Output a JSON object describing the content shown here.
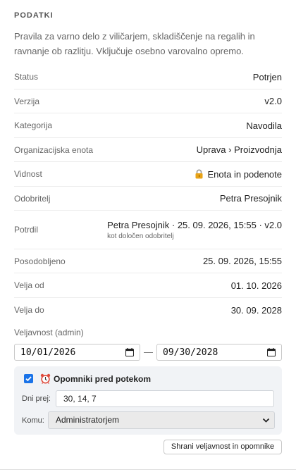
{
  "section": {
    "title": "PODATKI",
    "description": "Pravila za varno delo z viličarjem, skladiščenje na regalih in ravnanje ob razlitju. Vključuje osebno varovalno opremo."
  },
  "fields": [
    {
      "key": "Status",
      "value": "Potrjen"
    },
    {
      "key": "Verzija",
      "value": "v2.0"
    },
    {
      "key": "Kategorija",
      "value": "Navodila"
    },
    {
      "key": "Organizacijska enota",
      "value": "Uprava › Proizvodnja"
    },
    {
      "key": "Vidnost",
      "value": "Enota in podenote",
      "icon": "lock-icon"
    },
    {
      "key": "Odobritelj",
      "value": "Petra Presojnik"
    },
    {
      "key": "Potrdil",
      "value": "Petra Presojnik · 25. 09. 2026, 15:55 · v2.0",
      "sub": "kot določen odobritelj"
    },
    {
      "key": "Posodobljeno",
      "value": "25. 09. 2026, 15:55"
    },
    {
      "key": "Velja od",
      "value": "01. 10. 2026"
    },
    {
      "key": "Velja do",
      "value": "30. 09. 2028"
    }
  ],
  "validity_admin": {
    "label": "Veljavnost (admin)",
    "from": "10/01/2026",
    "to": "09/30/2028",
    "separator": "—"
  },
  "reminders": {
    "checked": true,
    "icon": "alarm-clock-icon",
    "title": "Opomniki pred potekom",
    "days_label": "Dni prej:",
    "days_value": "30, 14, 7",
    "to_label": "Komu:",
    "to_value": "Administratorjem"
  },
  "save_button": "Shrani veljavnost in opomnike",
  "colors": {
    "accent": "#1a73e8",
    "panel_bg": "#f1f3f6"
  }
}
